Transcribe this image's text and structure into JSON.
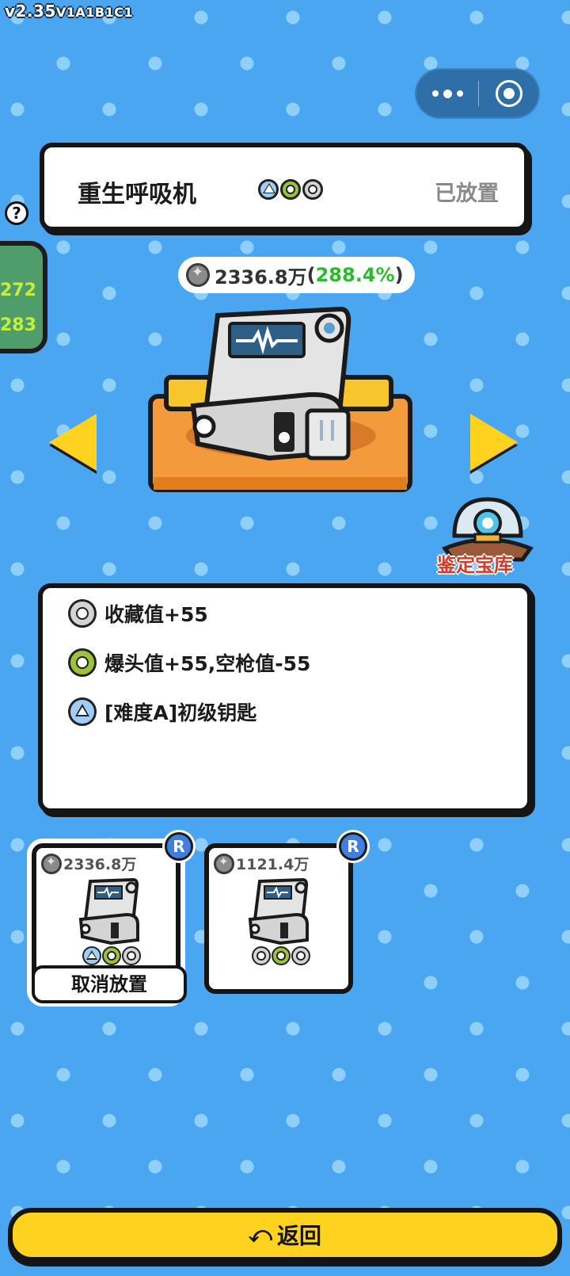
{
  "version": {
    "main": "v2.35",
    "sub": "V1A1B1C1"
  },
  "title": {
    "name": "重生呼吸机",
    "status": "已放置"
  },
  "help_symbol": "?",
  "side_panel": {
    "line1": "272",
    "line2": "283"
  },
  "value": {
    "amount": "2336.8万",
    "open": "(",
    "percent": "288.4%",
    "close": ")"
  },
  "vault_label": "鉴定宝库",
  "attributes": [
    {
      "icon": "gray-ring-icon",
      "text": "收藏值+55"
    },
    {
      "icon": "green-ring-icon",
      "text": "爆头值+55,空枪值-55"
    },
    {
      "icon": "triangle-icon",
      "text": "[难度A]初级钥匙"
    }
  ],
  "items": [
    {
      "value": "2336.8万",
      "rarity": "R",
      "selected": true,
      "action": "取消放置",
      "icons": [
        "triangle-icon",
        "green-ring-icon",
        "gray-ring-icon"
      ]
    },
    {
      "value": "1121.4万",
      "rarity": "R",
      "selected": false,
      "icons": [
        "gray-ring-icon",
        "green-ring-icon",
        "gray-ring-icon"
      ]
    }
  ],
  "back_button": {
    "icon": "return-icon",
    "glyph": "⤺",
    "label": "返回"
  },
  "colors": {
    "background": "#4aa6f0",
    "accent_yellow": "#ffd21f",
    "percent_green": "#2dbb2d",
    "rarity_blue": "#3f7fe0"
  }
}
